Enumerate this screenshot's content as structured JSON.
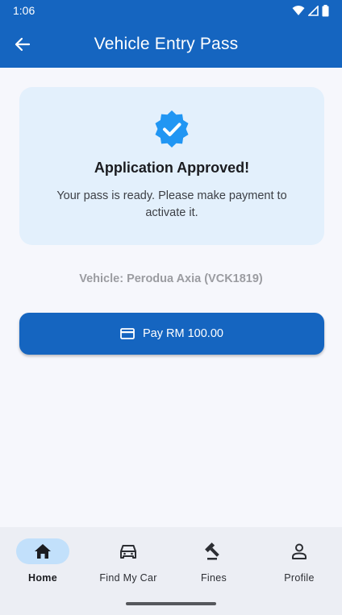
{
  "status_bar": {
    "time": "1:06"
  },
  "app_bar": {
    "title": "Vehicle Entry Pass"
  },
  "approval_card": {
    "title": "Application Approved!",
    "message": "Your pass is ready. Please make payment to activate it."
  },
  "vehicle": {
    "text": "Vehicle: Perodua Axia (VCK1819)"
  },
  "payment": {
    "button_label": "Pay RM 100.00"
  },
  "bottom_nav": {
    "items": [
      {
        "label": "Home",
        "icon": "home-icon",
        "active": true
      },
      {
        "label": "Find My Car",
        "icon": "car-icon",
        "active": false
      },
      {
        "label": "Fines",
        "icon": "gavel-icon",
        "active": false
      },
      {
        "label": "Profile",
        "icon": "person-icon",
        "active": false
      }
    ]
  },
  "colors": {
    "primary": "#1565c0",
    "card_bg": "#e3f0fc",
    "verified_icon": "#2196f3",
    "nav_active_pill": "#c2e0fb"
  }
}
